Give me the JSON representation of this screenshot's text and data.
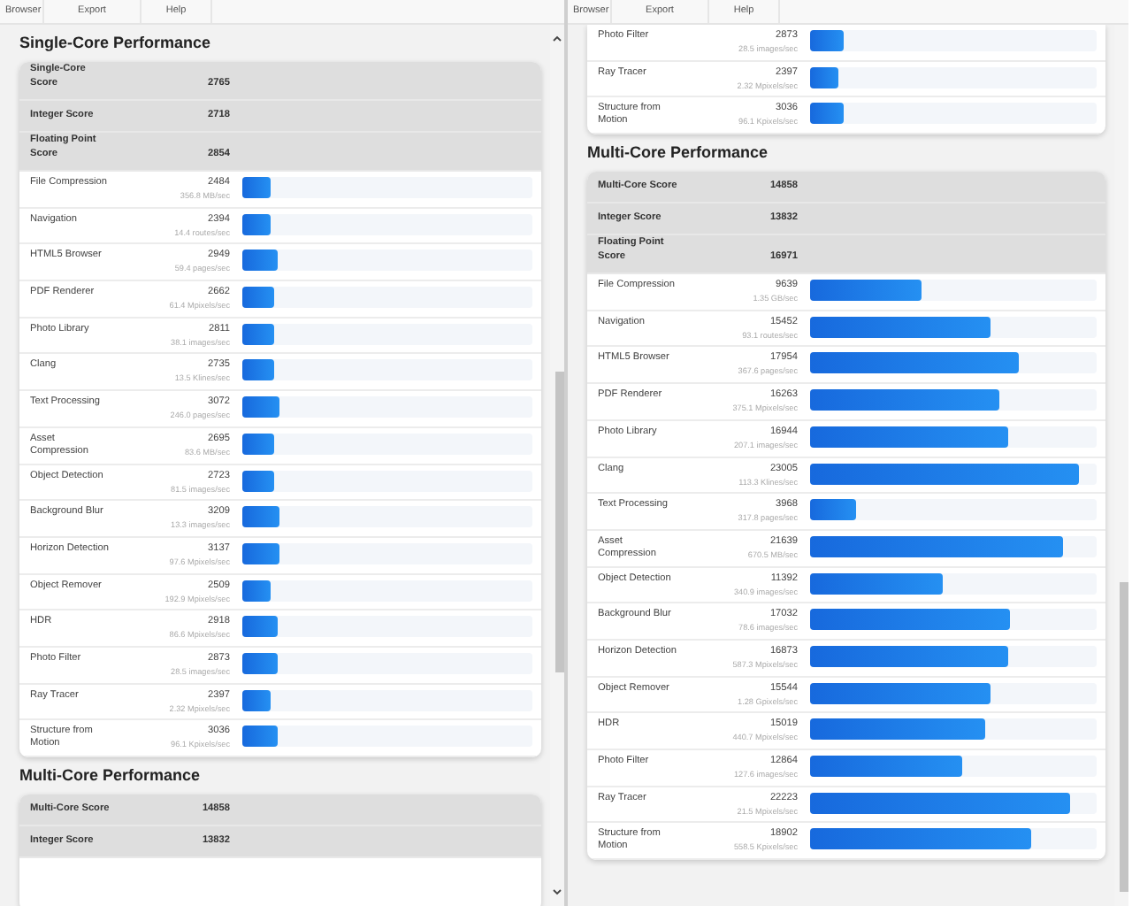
{
  "panes": [
    {
      "menu": [
        "Browser",
        "Export",
        "Help"
      ],
      "sections": [
        {
          "title": "Single-Core Performance",
          "summary": [
            {
              "label": "Single-Core\nScore",
              "score": "2765"
            },
            {
              "label": "Integer Score",
              "score": "2718"
            },
            {
              "label": "Floating Point\nScore",
              "score": "2854"
            }
          ],
          "rows": [
            {
              "name": "File Compression",
              "score": "2484",
              "rate": "356.8 MB/sec",
              "level": 0.1
            },
            {
              "name": "Navigation",
              "score": "2394",
              "rate": "14.4 routes/sec",
              "level": 0.1
            },
            {
              "name": "HTML5 Browser",
              "score": "2949",
              "rate": "59.4 pages/sec",
              "level": 0.12
            },
            {
              "name": "PDF Renderer",
              "score": "2662",
              "rate": "61.4 Mpixels/sec",
              "level": 0.11
            },
            {
              "name": "Photo Library",
              "score": "2811",
              "rate": "38.1 images/sec",
              "level": 0.11
            },
            {
              "name": "Clang",
              "score": "2735",
              "rate": "13.5 Klines/sec",
              "level": 0.11
            },
            {
              "name": "Text Processing",
              "score": "3072",
              "rate": "246.0 pages/sec",
              "level": 0.13
            },
            {
              "name": "Asset\nCompression",
              "score": "2695",
              "rate": "83.6 MB/sec",
              "level": 0.11
            },
            {
              "name": "Object Detection",
              "score": "2723",
              "rate": "81.5 images/sec",
              "level": 0.11
            },
            {
              "name": "Background Blur",
              "score": "3209",
              "rate": "13.3 images/sec",
              "level": 0.13
            },
            {
              "name": "Horizon Detection",
              "score": "3137",
              "rate": "97.6 Mpixels/sec",
              "level": 0.13
            },
            {
              "name": "Object Remover",
              "score": "2509",
              "rate": "192.9 Mpixels/sec",
              "level": 0.1
            },
            {
              "name": "HDR",
              "score": "2918",
              "rate": "86.6 Mpixels/sec",
              "level": 0.12
            },
            {
              "name": "Photo Filter",
              "score": "2873",
              "rate": "28.5 images/sec",
              "level": 0.12
            },
            {
              "name": "Ray Tracer",
              "score": "2397",
              "rate": "2.32 Mpixels/sec",
              "level": 0.1
            },
            {
              "name": "Structure from\nMotion",
              "score": "3036",
              "rate": "96.1 Kpixels/sec",
              "level": 0.12
            }
          ]
        },
        {
          "title": "Multi-Core Performance",
          "summary": [
            {
              "label": "Multi-Core Score",
              "score": "14858"
            },
            {
              "label": "Integer Score",
              "score": "13832"
            }
          ]
        }
      ]
    },
    {
      "menu": [
        "Browser",
        "Export",
        "Help"
      ],
      "sections": [
        {
          "rows": [
            {
              "name": "Photo Filter",
              "score": "2873",
              "rate": "28.5 images/sec",
              "level": 0.12
            },
            {
              "name": "Ray Tracer",
              "score": "2397",
              "rate": "2.32 Mpixels/sec",
              "level": 0.1
            },
            {
              "name": "Structure from\nMotion",
              "score": "3036",
              "rate": "96.1 Kpixels/sec",
              "level": 0.12
            }
          ]
        },
        {
          "title": "Multi-Core Performance",
          "summary": [
            {
              "label": "Multi-Core Score",
              "score": "14858"
            },
            {
              "label": "Integer Score",
              "score": "13832"
            },
            {
              "label": "Floating Point\nScore",
              "score": "16971"
            }
          ],
          "rows": [
            {
              "name": "File Compression",
              "score": "9639",
              "rate": "1.35 GB/sec",
              "level": 0.39
            },
            {
              "name": "Navigation",
              "score": "15452",
              "rate": "93.1 routes/sec",
              "level": 0.63
            },
            {
              "name": "HTML5 Browser",
              "score": "17954",
              "rate": "367.6 pages/sec",
              "level": 0.73
            },
            {
              "name": "PDF Renderer",
              "score": "16263",
              "rate": "375.1 Mpixels/sec",
              "level": 0.66
            },
            {
              "name": "Photo Library",
              "score": "16944",
              "rate": "207.1 images/sec",
              "level": 0.69
            },
            {
              "name": "Clang",
              "score": "23005",
              "rate": "113.3 Klines/sec",
              "level": 0.94
            },
            {
              "name": "Text Processing",
              "score": "3968",
              "rate": "317.8 pages/sec",
              "level": 0.16
            },
            {
              "name": "Asset\nCompression",
              "score": "21639",
              "rate": "670.5 MB/sec",
              "level": 0.88
            },
            {
              "name": "Object Detection",
              "score": "11392",
              "rate": "340.9 images/sec",
              "level": 0.46
            },
            {
              "name": "Background Blur",
              "score": "17032",
              "rate": "78.6 images/sec",
              "level": 0.7
            },
            {
              "name": "Horizon Detection",
              "score": "16873",
              "rate": "587.3 Mpixels/sec",
              "level": 0.69
            },
            {
              "name": "Object Remover",
              "score": "15544",
              "rate": "1.28 Gpixels/sec",
              "level": 0.63
            },
            {
              "name": "HDR",
              "score": "15019",
              "rate": "440.7 Mpixels/sec",
              "level": 0.61
            },
            {
              "name": "Photo Filter",
              "score": "12864",
              "rate": "127.6 images/sec",
              "level": 0.53
            },
            {
              "name": "Ray Tracer",
              "score": "22223",
              "rate": "21.5 Mpixels/sec",
              "level": 0.91
            },
            {
              "name": "Structure from\nMotion",
              "score": "18902",
              "rate": "558.5 Kpixels/sec",
              "level": 0.77
            }
          ]
        }
      ]
    }
  ]
}
